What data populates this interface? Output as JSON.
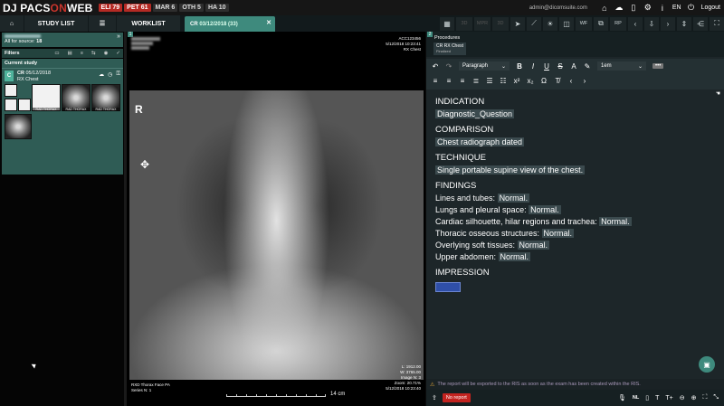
{
  "topbar": {
    "logo_dj": "DJ ",
    "logo_pacs": "PACS",
    "logo_on": "ON",
    "logo_web": "WEB",
    "badges": [
      {
        "label": "ELI 79",
        "style": "red"
      },
      {
        "label": "PET 61",
        "style": "red"
      },
      {
        "label": "MAR 6",
        "style": "dark"
      },
      {
        "label": "OTH 5",
        "style": "dark"
      },
      {
        "label": "HA 10",
        "style": "dark"
      }
    ],
    "user_email": "admin@dicomsuite.com",
    "lang": "EN",
    "logout": "Logout"
  },
  "nav": {
    "study_list": "STUDY LIST",
    "worklist": "WORKLIST",
    "tab_label": "CR",
    "tab_sub": "03/12/2018 (33)"
  },
  "tools": {
    "t3d": "3D",
    "mpr": "MPR",
    "s3d": "3D",
    "wf": "WF",
    "rp": "RP"
  },
  "left_panel": {
    "source_label": "All for source: ",
    "source_count": "18",
    "filters_label": "Filters",
    "current_study_label": "Current study",
    "study": {
      "avatar": "C",
      "modality": "CR",
      "date": "05/12/2018",
      "description": "RX Chest"
    },
    "thumbs": [
      {
        "caption": ""
      },
      {
        "caption": "RAD THORAX"
      },
      {
        "caption": "RAD THORAX"
      },
      {
        "caption": "RAD THORAX"
      },
      {
        "caption": ""
      }
    ]
  },
  "viewer": {
    "marker": "R",
    "top_right": [
      "ACC123456",
      "5/12/2018 10:23:41",
      "RX Chest"
    ],
    "bottom_right": [
      "L: 1912.00",
      "W: 3765.00",
      "Image N: 3",
      "Zoom: 20.71%",
      "5/12/2018 10:23:40"
    ],
    "bottom_left": [
      "RXD Thorax Face PA",
      "Series N: 1"
    ],
    "scale_label": "14 cm"
  },
  "report": {
    "procedures_label": "Procedures",
    "procedure_name": "CR RX Chest",
    "procedure_status": "Finalized",
    "toolbar": {
      "paragraph": "Paragraph",
      "size": "1em"
    },
    "sections": [
      {
        "title": "INDICATION",
        "lines": [
          {
            "text": "Diagnostic_Question",
            "value": ""
          }
        ]
      },
      {
        "title": "COMPARISON",
        "lines": [
          {
            "text": "Chest radiograph dated",
            "value": ""
          }
        ]
      },
      {
        "title": "TECHNIQUE",
        "lines": [
          {
            "text": "Single portable supine view of the chest.",
            "value": ""
          }
        ]
      },
      {
        "title": "FINDINGS",
        "lines": [
          {
            "text": "Lines and tubes: ",
            "value": "Normal."
          },
          {
            "text": "Lungs and pleural space: ",
            "value": "Normal."
          },
          {
            "text": "Cardiac silhouette, hilar regions and trachea: ",
            "value": "Normal."
          },
          {
            "text": "Thoracic osseous structures: ",
            "value": "Normal."
          },
          {
            "text": "Overlying soft tissues: ",
            "value": "Normal."
          },
          {
            "text": "Upper abdomen: ",
            "value": "Normal."
          }
        ]
      },
      {
        "title": "IMPRESSION",
        "lines": []
      }
    ],
    "notice": "The report will be exported to the RIS as soon as the exam has been created within the RIS.",
    "no_report": "No report",
    "nl": "NL"
  }
}
